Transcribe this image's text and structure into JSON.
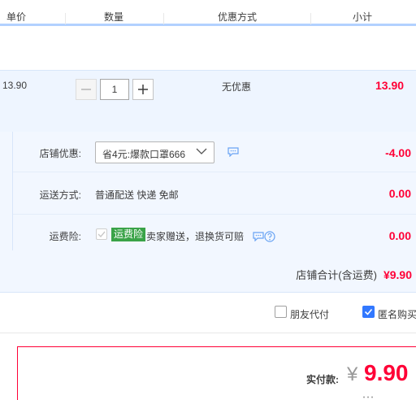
{
  "header": {
    "price": "单价",
    "quantity": "数量",
    "promotion": "优惠方式",
    "subtotal": "小计"
  },
  "item": {
    "price": "13.90",
    "quantity": "1",
    "minus": "−",
    "plus": "+",
    "promotion": "无优惠",
    "subtotal": "13.90"
  },
  "shop": {
    "coupon_label": "店铺优惠:",
    "coupon_value": "省4元:爆款口罩666",
    "coupon_amount": "-4.00",
    "shipping_label": "运送方式:",
    "shipping_value": "普通配送 快递 免邮",
    "shipping_amount": "0.00",
    "insurance_label": "运费险:",
    "insurance_badge": "运费险",
    "insurance_text": "卖家赠送，退换货可赔",
    "insurance_amount": "0.00",
    "total_label": "店铺合计(含运费)",
    "total_value": "¥9.90"
  },
  "options": {
    "friend_pay": "朋友代付",
    "anonymous": "匿名购买",
    "anonymous_checked": true
  },
  "payment": {
    "label": "实付款:",
    "currency": "¥",
    "amount": "9.90"
  },
  "colors": {
    "accent_red": "#ff0036",
    "accent_blue": "#3278ff",
    "row_bg": "#eef5ff",
    "insurance_green": "#3aa348"
  },
  "icons": [
    "minus-icon",
    "plus-icon",
    "chevron-down-icon",
    "chat-icon",
    "question-icon",
    "check-icon"
  ]
}
